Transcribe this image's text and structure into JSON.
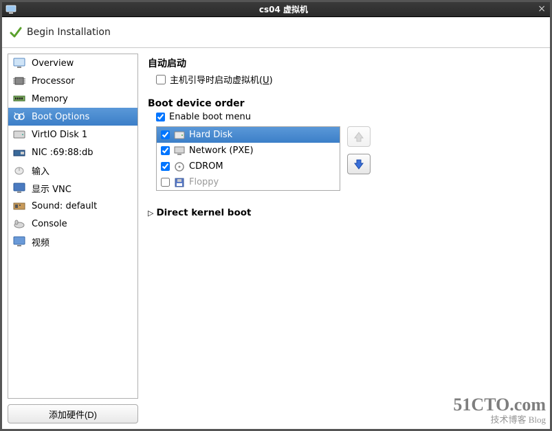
{
  "window": {
    "title": "cs04 虚拟机",
    "close_tooltip": "Close"
  },
  "toolbar": {
    "begin_installation": "Begin Installation"
  },
  "sidebar": {
    "items": [
      {
        "id": "overview",
        "label": "Overview"
      },
      {
        "id": "processor",
        "label": "Processor"
      },
      {
        "id": "memory",
        "label": "Memory"
      },
      {
        "id": "boot",
        "label": "Boot Options",
        "selected": true
      },
      {
        "id": "disk",
        "label": "VirtIO Disk 1"
      },
      {
        "id": "nic",
        "label": "NIC :69:88:db"
      },
      {
        "id": "input",
        "label": "输入"
      },
      {
        "id": "display",
        "label": "显示 VNC"
      },
      {
        "id": "sound",
        "label": "Sound: default"
      },
      {
        "id": "console",
        "label": "Console"
      },
      {
        "id": "video",
        "label": "视频"
      }
    ],
    "add_hardware": "添加硬件(D)"
  },
  "content": {
    "autostart_title": "自动启动",
    "autostart_checkbox": "主机引导时启动虚拟机(U)",
    "autostart_checked": false,
    "bootorder_title": "Boot device order",
    "enable_boot_menu_label": "Enable boot menu",
    "enable_boot_menu_checked": true,
    "boot_devices": [
      {
        "label": "Hard Disk",
        "checked": true,
        "selected": true,
        "icon": "hdd"
      },
      {
        "label": "Network (PXE)",
        "checked": true,
        "selected": false,
        "icon": "net"
      },
      {
        "label": "CDROM",
        "checked": true,
        "selected": false,
        "icon": "cd"
      },
      {
        "label": "Floppy",
        "checked": false,
        "selected": false,
        "icon": "floppy",
        "disabled": true
      }
    ],
    "direct_kernel_boot": "Direct kernel boot"
  },
  "watermark": {
    "line1": "51CTO.com",
    "line2": "技术博客   Blog"
  }
}
